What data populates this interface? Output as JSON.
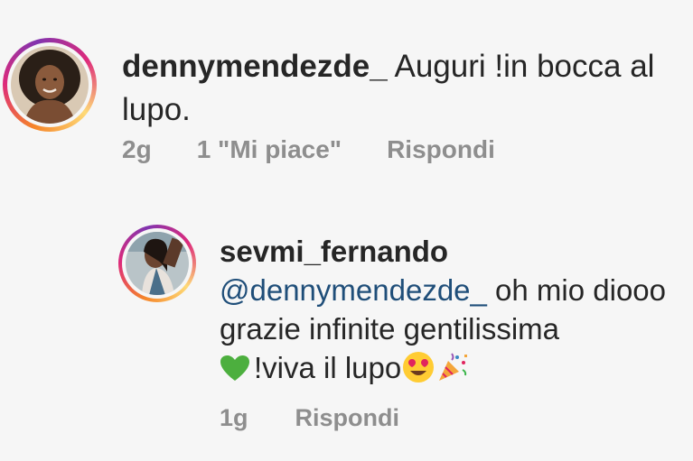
{
  "comments": [
    {
      "username": "dennymendezde_",
      "text": "Auguri !in bocca al lupo.",
      "time": "2g",
      "likes": "1 \"Mi piace\"",
      "reply_label": "Rispondi"
    },
    {
      "username": "sevmi_fernando",
      "mention": "@dennymendezde_",
      "text": "oh mio diooo grazie infinite gentilissima",
      "text_line3": "!viva il lupo",
      "emojis": [
        "green-heart",
        "smiling-face-heart-eyes",
        "party-popper"
      ],
      "time": "1g",
      "reply_label": "Rispondi"
    }
  ],
  "colors": {
    "username": "#262626",
    "mention": "#1f4e79",
    "meta": "#8e8e8e",
    "background": "#f6f6f6"
  }
}
